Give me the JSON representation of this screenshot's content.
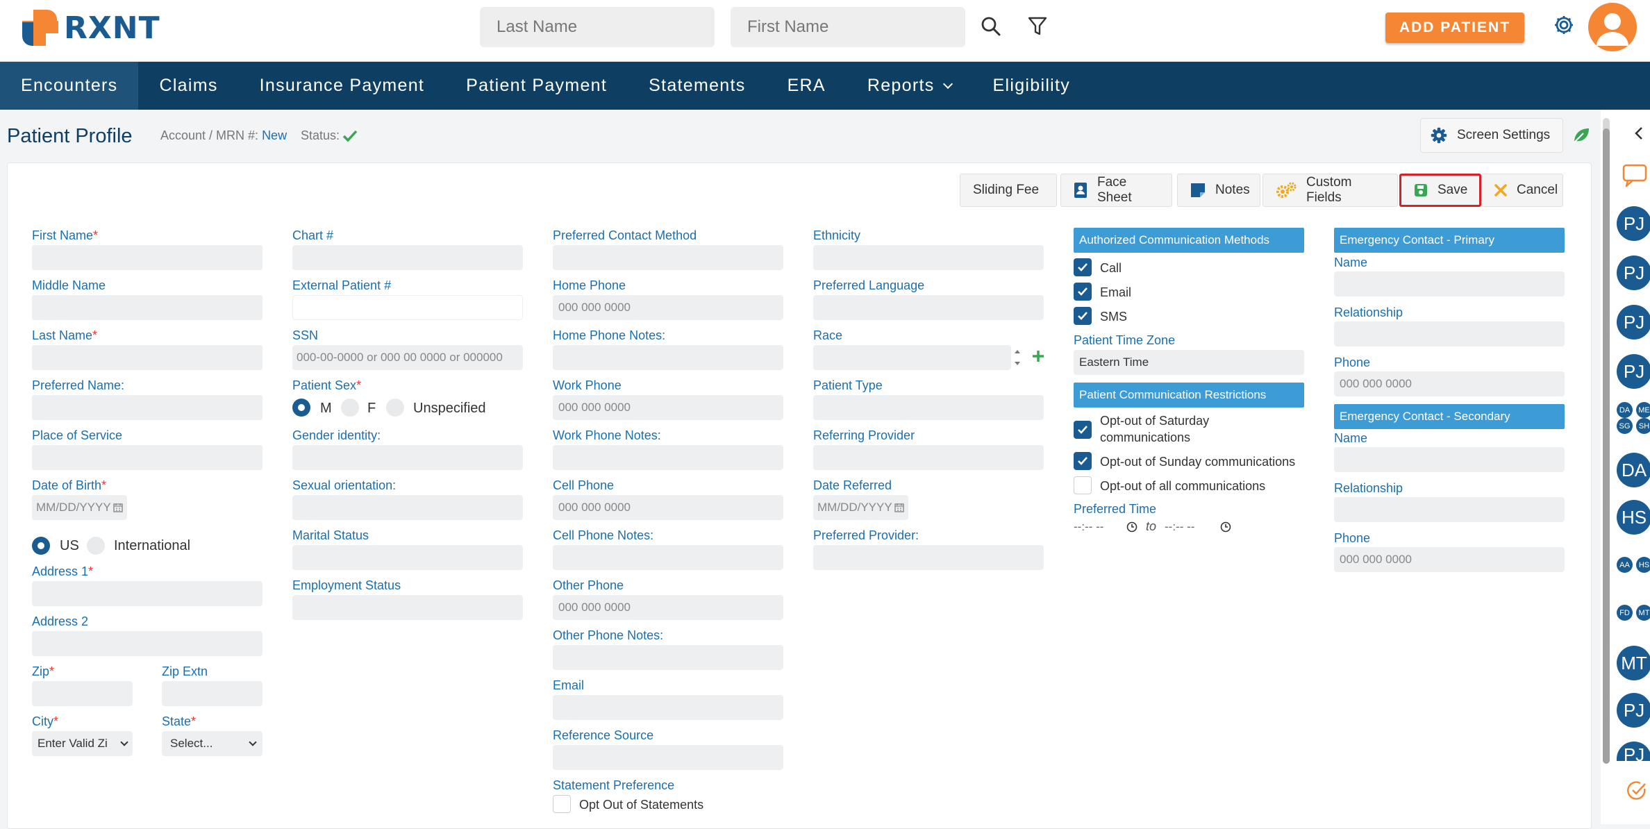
{
  "brand": {
    "logo_text": "RXNT",
    "accent": "#f58634",
    "navy": "#0e3f63",
    "link_blue": "#1a6fb0"
  },
  "search": {
    "last_name_placeholder": "Last Name",
    "first_name_placeholder": "First Name"
  },
  "header": {
    "add_patient_label": "ADD PATIENT"
  },
  "nav": {
    "items": [
      {
        "label": "Encounters",
        "active": true
      },
      {
        "label": "Claims"
      },
      {
        "label": "Insurance Payment"
      },
      {
        "label": "Patient Payment"
      },
      {
        "label": "Statements"
      },
      {
        "label": "ERA"
      },
      {
        "label": "Reports",
        "has_dropdown": true
      },
      {
        "label": "Eligibility"
      }
    ]
  },
  "page": {
    "title": "Patient Profile",
    "account_label": "Account / MRN #:",
    "account_value": "New",
    "status_label": "Status:",
    "screen_settings_label": "Screen Settings"
  },
  "toolbar": {
    "sliding_fee": "Sliding Fee",
    "face_sheet": "Face Sheet",
    "notes": "Notes",
    "custom_fields": "Custom Fields",
    "save": "Save",
    "cancel": "Cancel"
  },
  "col1": {
    "first_name": "First Name",
    "middle_name": "Middle Name",
    "last_name": "Last Name",
    "preferred_name": "Preferred Name:",
    "place_of_service": "Place of Service",
    "dob": "Date of Birth",
    "dob_placeholder": "MM/DD/YYYY",
    "us": "US",
    "international": "International",
    "address1": "Address 1",
    "address2": "Address 2",
    "zip": "Zip",
    "zip_extn": "Zip Extn",
    "city": "City",
    "city_value": "Enter Valid Zi",
    "state": "State",
    "state_value": "Select..."
  },
  "col2": {
    "chart": "Chart #",
    "external_patient": "External Patient #",
    "ssn": "SSN",
    "ssn_placeholder": "000-00-0000 or 000 00 0000 or 000000",
    "patient_sex": "Patient Sex",
    "sex_m": "M",
    "sex_f": "F",
    "sex_unspecified": "Unspecified",
    "gender_identity": "Gender identity:",
    "sexual_orientation": "Sexual orientation:",
    "marital_status": "Marital Status",
    "employment_status": "Employment Status"
  },
  "col3": {
    "preferred_contact": "Preferred Contact Method",
    "home_phone": "Home Phone",
    "phone_placeholder": "000 000 0000",
    "home_phone_notes": "Home Phone Notes:",
    "work_phone": "Work Phone",
    "work_phone_notes": "Work Phone Notes:",
    "cell_phone": "Cell Phone",
    "cell_phone_notes": "Cell Phone Notes:",
    "other_phone": "Other Phone",
    "other_phone_notes": "Other Phone Notes:",
    "email": "Email",
    "reference_source": "Reference Source",
    "statement_preference": "Statement Preference",
    "opt_out_statements": "Opt Out of Statements"
  },
  "col4": {
    "ethnicity": "Ethnicity",
    "preferred_language": "Preferred Language",
    "race": "Race",
    "patient_type": "Patient Type",
    "referring_provider": "Referring Provider",
    "date_referred": "Date Referred",
    "date_placeholder": "MM/DD/YYYY",
    "preferred_provider": "Preferred Provider:"
  },
  "col5": {
    "auth_header": "Authorized Communication Methods",
    "call": "Call",
    "email": "Email",
    "sms": "SMS",
    "time_zone_label": "Patient Time Zone",
    "time_zone_value": "Eastern Time",
    "restrictions_header": "Patient Communication Restrictions",
    "opt_saturday": "Opt-out of Saturday communications",
    "opt_sunday": "Opt-out of Sunday communications",
    "opt_all": "Opt-out of all communications",
    "preferred_time": "Preferred Time",
    "time_placeholder": "--:-- --",
    "to": "to"
  },
  "col6": {
    "primary_header": "Emergency Contact - Primary",
    "secondary_header": "Emergency Contact - Secondary",
    "name": "Name",
    "relationship": "Relationship",
    "phone": "Phone",
    "phone_placeholder": "000 000 0000"
  },
  "rail": {
    "avatars": [
      "PJ",
      "PJ",
      "PJ",
      "PJ",
      "DA",
      "ME",
      "SG",
      "SH",
      "DA",
      "HS",
      "AA",
      "HS",
      "FD",
      "MT",
      "MT",
      "PJ",
      "PJ"
    ]
  }
}
